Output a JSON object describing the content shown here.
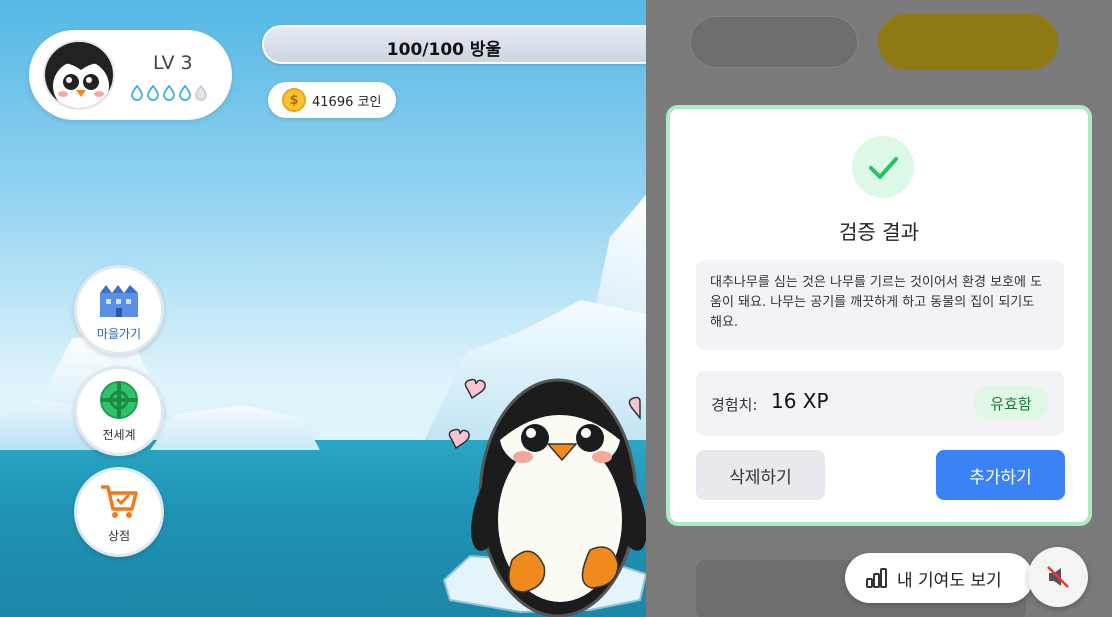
{
  "profile": {
    "level": "LV 3",
    "drops_filled": 4,
    "drops_total": 5
  },
  "water": {
    "label": "100/100 방울",
    "current": 100,
    "max": 100
  },
  "coins": {
    "label": "41696 코인",
    "symbol": "$"
  },
  "nav": [
    {
      "label": "마을가기",
      "icon": "village-icon"
    },
    {
      "label": "전세계",
      "icon": "globe-icon"
    },
    {
      "label": "상점",
      "icon": "cart-icon"
    }
  ],
  "dialog": {
    "title": "검증 결과",
    "message": "대추나무를 심는 것은 나무를 기르는 것이어서 환경 보호에 도움이 돼요. 나무는 공기를 깨끗하게 하고 동물의 집이 되기도 해요.",
    "xp_label": "경험치:",
    "xp_value": "16 XP",
    "status": "유효함",
    "delete_label": "삭제하기",
    "add_label": "추가하기"
  },
  "contribution_label": "내 기여도 보기",
  "colors": {
    "accent": "#3b82f6",
    "success": "#22c55e",
    "dialog_border": "#a8ecc0",
    "coin": "#f7c430"
  }
}
